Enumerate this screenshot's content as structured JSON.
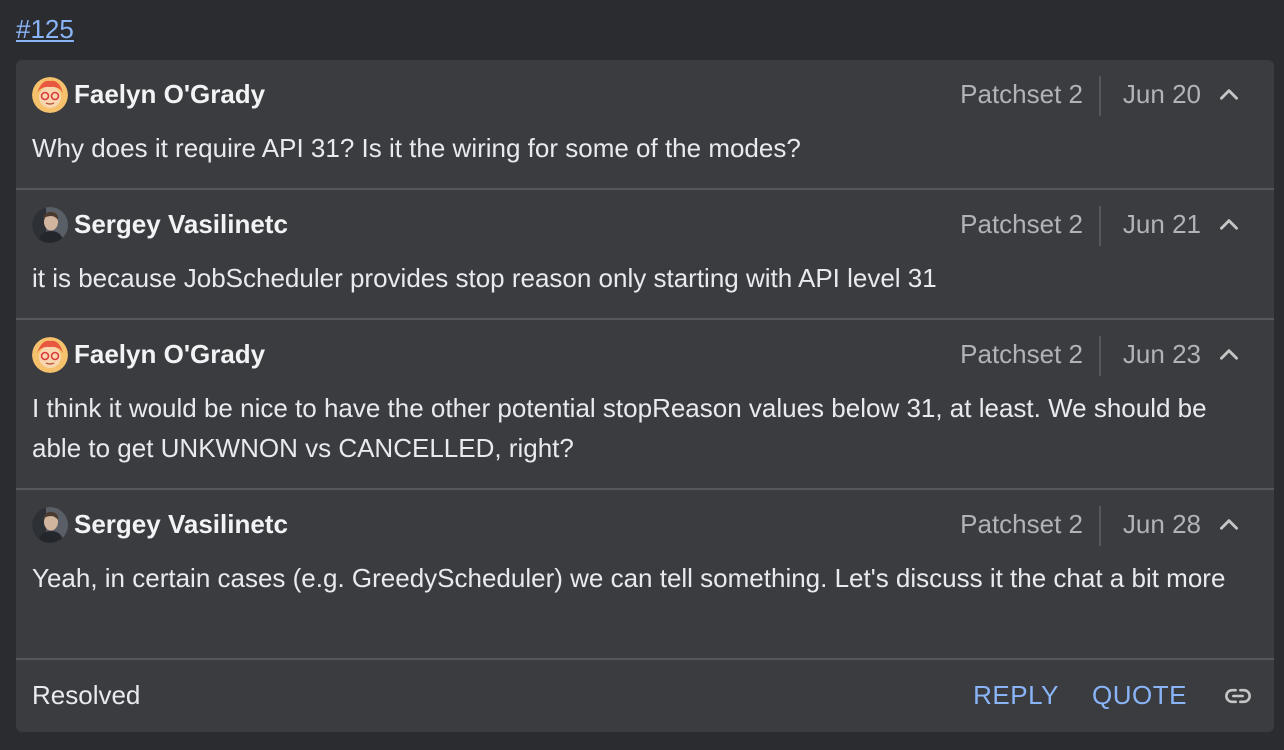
{
  "thread": {
    "link_text": "#125",
    "comments": [
      {
        "author": "Faelyn O'Grady",
        "avatar": "avatar-cartoon-icon",
        "patchset": "Patchset 2",
        "date": "Jun 20",
        "text": "Why does it require API 31? Is it the wiring for some of the modes?"
      },
      {
        "author": "Sergey Vasilinetc",
        "avatar": "avatar-photo-icon",
        "patchset": "Patchset 2",
        "date": "Jun 21",
        "text": "it is because JobScheduler provides stop reason only starting with API level 31"
      },
      {
        "author": "Faelyn O'Grady",
        "avatar": "avatar-cartoon-icon",
        "patchset": "Patchset 2",
        "date": "Jun 23",
        "text": "I think it would be nice to have the other potential stopReason values below 31, at least. We should be able to get UNKWNON vs CANCELLED, right?"
      },
      {
        "author": "Sergey Vasilinetc",
        "avatar": "avatar-photo-icon",
        "patchset": "Patchset 2",
        "date": "Jun 28",
        "text": "Yeah, in certain cases (e.g. GreedyScheduler) we can tell something. Let's discuss it the chat a bit more"
      }
    ],
    "footer": {
      "status": "Resolved",
      "reply_label": "REPLY",
      "quote_label": "QUOTE",
      "link_icon": "link-icon"
    }
  },
  "colors": {
    "background": "#2b2c2f",
    "panel": "#3b3c40",
    "accent": "#8ab4f8",
    "divider": "#55575b"
  }
}
